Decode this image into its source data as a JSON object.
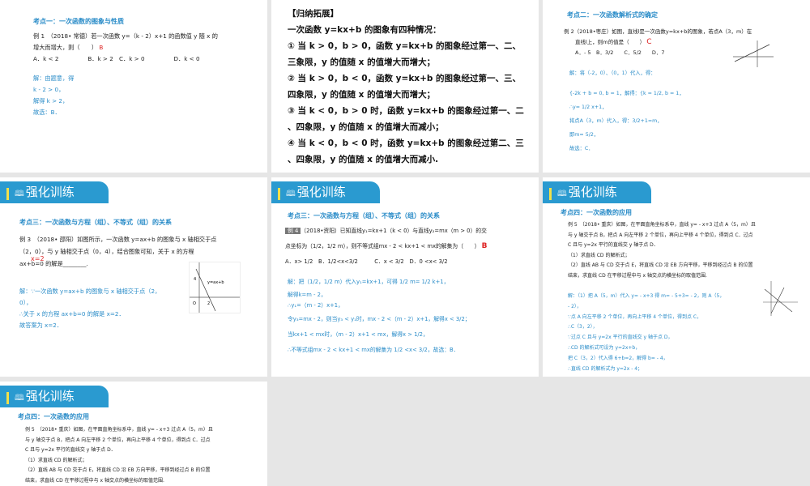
{
  "slides": [
    {
      "heading": "考点一：一次函数的图象与性质",
      "lines": [
        "例 1　（2018• 常德）若一次函数 y=（k - 2）x+1 的函数值 y 随 x 的",
        "增大而增大，则（　　）",
        "A．k < 2　　　　　B．k > 2　C．k > 0　　　　　D．k < 0"
      ],
      "answer": "B",
      "solution": [
        "解：由题意，得",
        "k - 2 > 0，",
        "解得 k > 2，",
        "故选：B．"
      ]
    },
    {
      "title": "【归纳拓展】",
      "lines": [
        "一次函数 y=kx+b 的图象有四种情况：",
        "① 当 k > 0，b > 0，函数 y=kx+b 的图象经过第一、二、",
        "三象限，y 的值随 x 的值增大而增大；",
        "② 当 k > 0，b < 0，函数 y=kx+b 的图象经过第一、三、",
        "四象限，y 的值随 x 的值增大而增大；",
        "③ 当 k < 0，b > 0 时，函数 y=kx+b 的图象经过第一、二",
        "、四象限，y 的值随 x 的值增大而减小；",
        "④ 当 k < 0，b < 0 时，函数 y=kx+b 的图象经过第二、三",
        "、四象限，y 的值随 x 的值增大而减小."
      ]
    },
    {
      "heading": "考点二：一次函数解析式的确定",
      "lines": [
        "例 2（2018•枣庄）如图，直线l是一次函数y=kx+b的图象，若点A（3，m）在",
        "直线l上，则m的值是（　　）",
        "A．- 5　B．3/2　　C．5/2　　D．7"
      ],
      "answer": "C",
      "solution": [
        "解：将（-2，0）、（0，1）代入，得：",
        "{-2k + b = 0, b = 1，解得：{k = 1/2, b = 1，",
        "∴y= 1/2 x+1，",
        "将点A（3，m）代入，得：3/2+1=m，",
        "即m= 5/2，",
        "故选：C．"
      ]
    },
    {
      "banner": "强化训练",
      "heading": "考点三：一次函数与方程（组）、不等式（组）的关系",
      "lines": [
        "例 3　（2018• 邵阳）如图所示，一次函数 y=ax+b 的图象与 x 轴相交于点",
        "（2，0），与 y 轴相交于点（0，4），结合图象可知，关于 x 的方程",
        "ax+b=0 的解是________."
      ],
      "answer": "x=2",
      "figure_label": "y=ax+b",
      "solution": [
        "解：∵一次函数 y=ax+b 的图象与 x 轴相交于点（2，",
        "0），",
        "∴关于 x 的方程 ax+b=0 的解是 x=2．",
        "故答案为 x=2．"
      ]
    },
    {
      "banner": "强化训练",
      "heading": "考点三：一次函数与方程（组）、不等式（组）的关系",
      "tag": "例 4",
      "lines": [
        "（2018•资阳）已知直线y₁=kx+1（k < 0）与直线y₂=mx（m > 0）的交",
        "点坐标为（1/2，1/2 m），则不等式组mx - 2 < kx+1 < mx的解集为（　　）",
        "A．x> 1/2　B．1/2<x<3/2　　　C．x < 3/2　D．0 <x< 3/2"
      ],
      "answer": "B",
      "solution": [
        "解：把（1/2，1/2 m）代入y₁=kx+1，可得 1/2 m= 1/2 k+1，",
        "解得k=m - 2，",
        "∴y₁=（m - 2）x+1，",
        "令y₃=mx - 2，则当y₃ < y₁时，mx - 2 <（m - 2）x+1，解得x < 3/2；",
        "当kx+1 < mx时，（m - 2）x+1 < mx，解得x > 1/2，",
        "∴不等式组mx - 2 < kx+1 < mx的解集为 1/2 <x< 3/2，故选：B．"
      ]
    },
    {
      "banner": "强化训练",
      "heading": "考点四：一次函数的应用",
      "lines": [
        "例 5　（2018• 重庆）如图，在平面直角坐标系中，直线 y= - x+3 过点 A（5，m）且",
        "与 y 轴交于点 B，把点 A 向左平移 2 个单位，再向上平移 4 个单位，得到点 C．过点",
        "C 且与 y=2x 平行的直线交 y 轴于点 D．",
        "（1）求直线 CD 的解析式；",
        "（2）直线 AB 与 CD 交于点 E，将直线 CD 沿 EB 方向平移，平移到经过点 B 的位置",
        "结束，求直线 CD 在平移过程中与 x 轴交点的横坐标的取值范围."
      ],
      "solution": [
        "解：（1）把 A（5，m）代入 y= - x+3 得 m= - 5+3= - 2，则 A（5，",
        "- 2），",
        "∵点 A 向左平移 2 个单位，再向上平移 4 个单位，得到点 C，",
        "∴C（3，2），",
        "∵过点 C 且与 y=2x 平行的直线交 y 轴于点 D，",
        "∴CD 的解析式可设为 y=2x+b，",
        "把 C（3，2）代入得 6+b=2，解得 b= - 4，",
        "∴直线 CD 的解析式为 y=2x - 4；"
      ]
    },
    {
      "banner": "强化训练",
      "heading": "考点四：一次函数的应用",
      "lines": [
        "例 5　（2018• 重庆）如图，在平面直角坐标系中，直线 y= - x+3 过点 A（5，m）且",
        "与 y 轴交于点 B，把点 A 向左平移 2 个单位，再向上平移 4 个单位，得到点 C．过点",
        "C 且与 y=2x 平行的直线交 y 轴于点 D．",
        "（1）求直线 CD 的解析式；",
        "（2）直线 AB 与 CD 交于点 E，将直线 CD 沿 EB 方向平移，平移到经过点 B 的位置",
        "结束，求直线 CD 在平移过程中与 x 轴交点的横坐标的取值范围."
      ]
    }
  ]
}
